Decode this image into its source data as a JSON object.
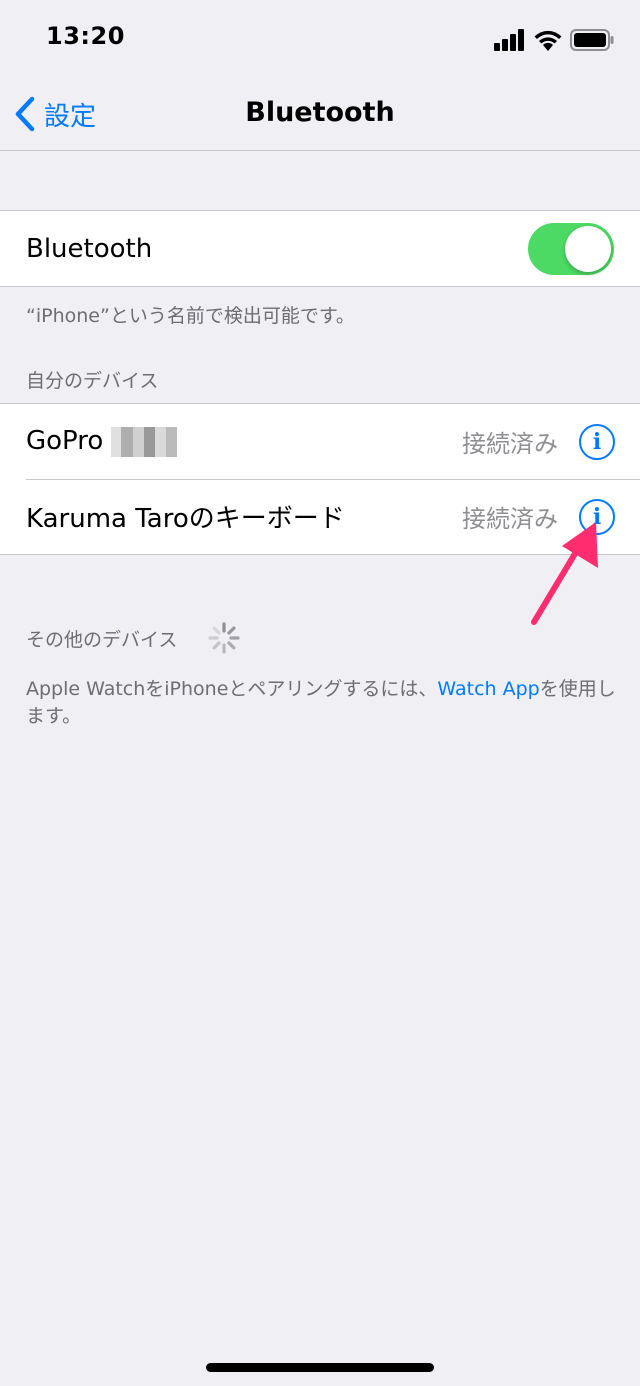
{
  "status_bar": {
    "time": "13:20",
    "icons": [
      "signal-icon",
      "wifi-icon",
      "battery-icon"
    ]
  },
  "nav": {
    "back_label": "設定",
    "title": "Bluetooth"
  },
  "bluetooth": {
    "label": "Bluetooth",
    "enabled": true,
    "discoverable_note": "“iPhone”という名前で検出可能です。"
  },
  "my_devices": {
    "header": "自分のデバイス",
    "items": [
      {
        "name": "GoPro",
        "status": "接続済み"
      },
      {
        "name": "Karuma Taroのキーボード",
        "status": "接続済み"
      }
    ]
  },
  "other_devices": {
    "header": "その他のデバイス"
  },
  "footer": {
    "text_before": "Apple WatchをiPhoneとペアリングするには、",
    "link": "Watch App",
    "text_after": "を使用します。"
  },
  "colors": {
    "accent": "#007aff",
    "toggle_on": "#4cd964",
    "arrow": "#ff2d6f",
    "background": "#efeff4"
  }
}
